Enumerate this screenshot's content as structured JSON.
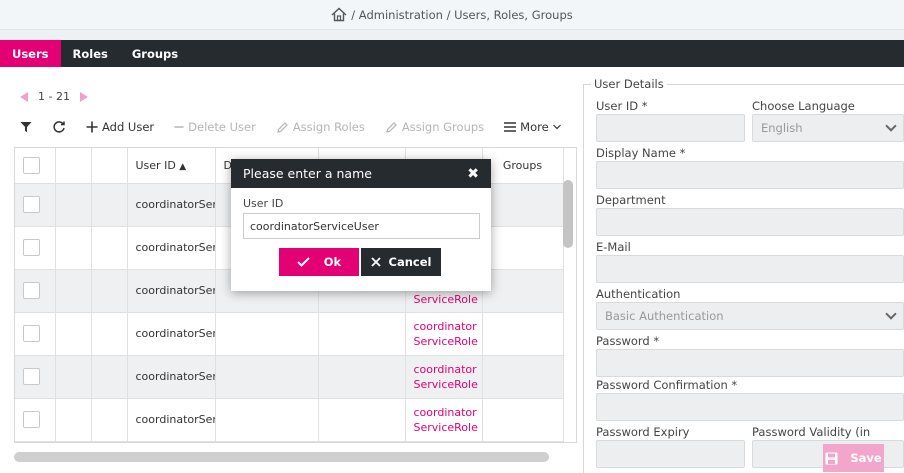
{
  "breadcrumb": {
    "path": "/ Administration / Users, Roles, Groups"
  },
  "nav": {
    "tabs": [
      "Users",
      "Roles",
      "Groups"
    ]
  },
  "pager": {
    "range": "1 - 21"
  },
  "toolbar": {
    "add_user": "Add User",
    "delete_user": "Delete User",
    "assign_roles": "Assign Roles",
    "assign_groups": "Assign Groups",
    "more": "More"
  },
  "table": {
    "headers": {
      "user_id": "User ID",
      "display_name_partial": "D",
      "groups": "Groups"
    },
    "rows": [
      {
        "user_id": "coordinatorSer",
        "role_line1": "",
        "role_line2": ""
      },
      {
        "user_id": "coordinatorSer",
        "role_line1": "",
        "role_line2": ""
      },
      {
        "user_id": "coordinatorSer",
        "role_line1": "",
        "role_line2": "ServiceRole"
      },
      {
        "user_id": "coordinatorSer",
        "role_line1": "coordinator",
        "role_line2": "ServiceRole"
      },
      {
        "user_id": "coordinatorSer",
        "role_line1": "coordinator",
        "role_line2": "ServiceRole"
      },
      {
        "user_id": "coordinatorSer",
        "role_line1": "coordinator",
        "role_line2": "ServiceRole"
      }
    ]
  },
  "dialog": {
    "title": "Please enter a name",
    "field_label": "User ID",
    "field_value": "coordinatorServiceUser",
    "ok_label": "Ok",
    "cancel_label": "Cancel"
  },
  "details": {
    "legend": "User Details",
    "user_id_label": "User ID  *",
    "language_label": "Choose Language",
    "language_value": "English",
    "display_name_label": "Display Name  *",
    "department_label": "Department",
    "email_label": "E-Mail",
    "auth_label": "Authentication",
    "auth_value": "Basic Authentication",
    "password_label": "Password  *",
    "password_confirm_label": "Password Confirmation  *",
    "password_expiry_label": "Password Expiry",
    "password_validity_label": "Password Validity (in hours)",
    "save_label": "Save"
  },
  "colors": {
    "accent": "#e20074",
    "dark": "#262b30",
    "accent_disabled": "#f3a6cb"
  }
}
